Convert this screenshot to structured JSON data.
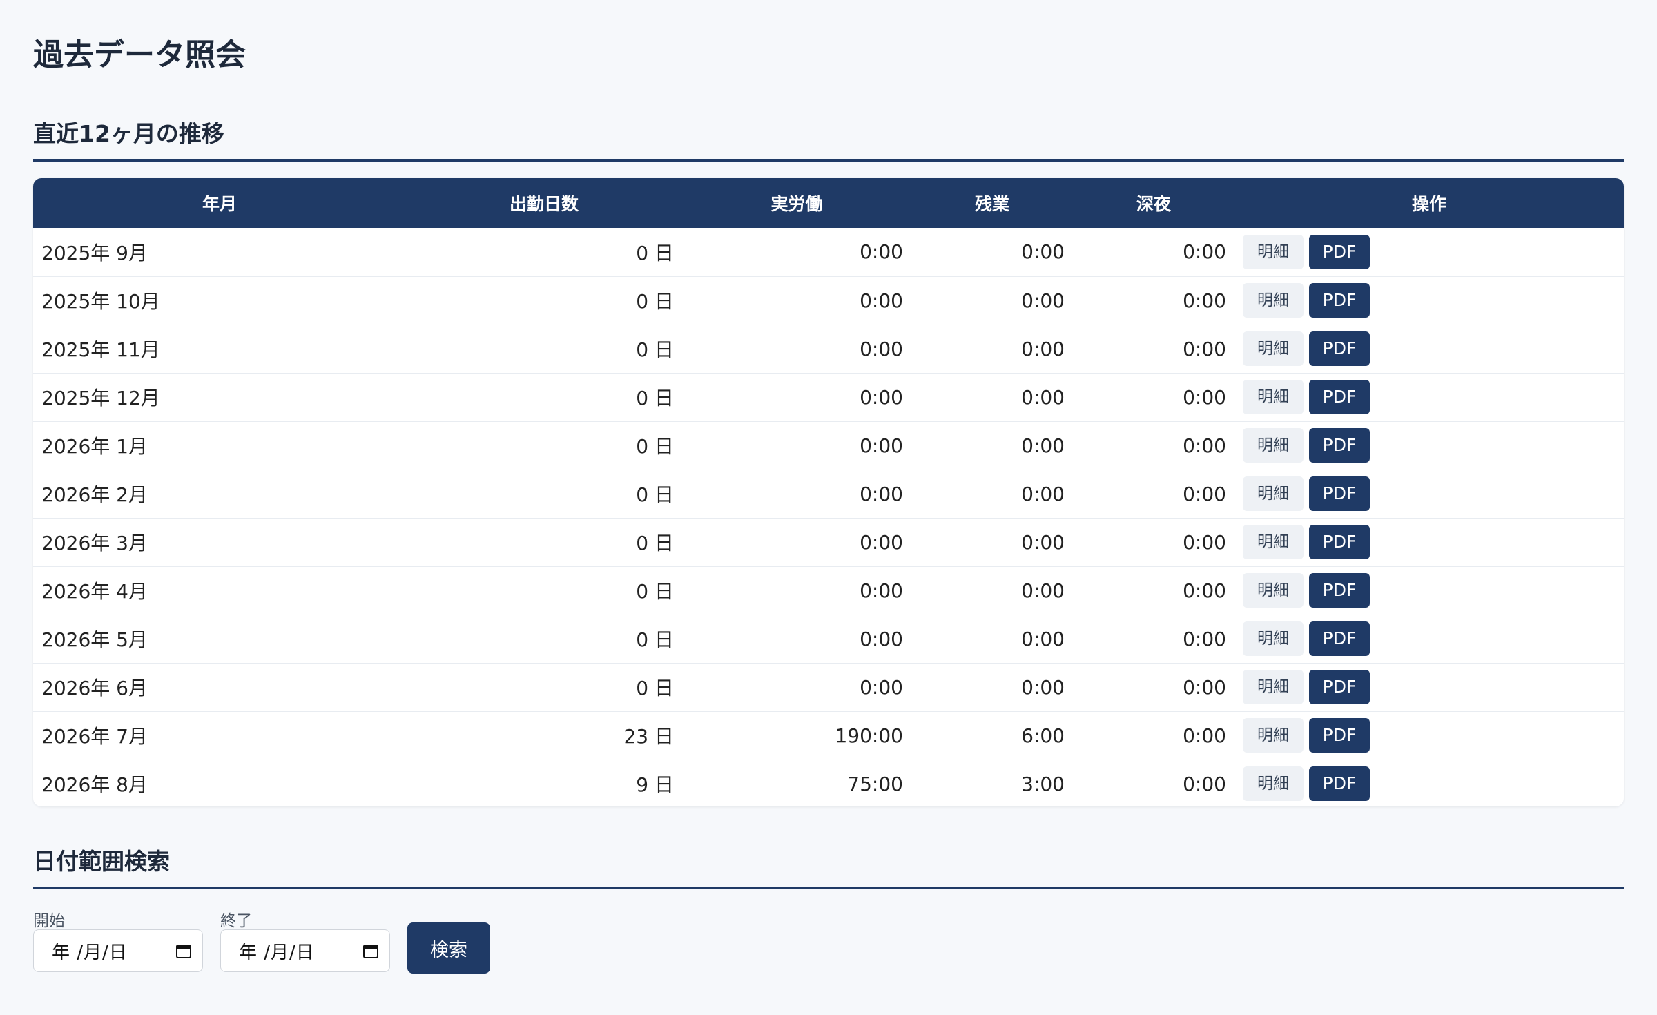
{
  "page": {
    "title": "過去データ照会"
  },
  "trend": {
    "title": "直近12ヶ月の推移",
    "columns": [
      "年月",
      "出勤日数",
      "実労働",
      "残業",
      "深夜",
      "操作"
    ],
    "detail_label": "明細",
    "pdf_label": "PDF",
    "rows": [
      {
        "ym": "2025年 9月",
        "days": "0 日",
        "work": "0:00",
        "overtime": "0:00",
        "night": "0:00"
      },
      {
        "ym": "2025年 10月",
        "days": "0 日",
        "work": "0:00",
        "overtime": "0:00",
        "night": "0:00"
      },
      {
        "ym": "2025年 11月",
        "days": "0 日",
        "work": "0:00",
        "overtime": "0:00",
        "night": "0:00"
      },
      {
        "ym": "2025年 12月",
        "days": "0 日",
        "work": "0:00",
        "overtime": "0:00",
        "night": "0:00"
      },
      {
        "ym": "2026年 1月",
        "days": "0 日",
        "work": "0:00",
        "overtime": "0:00",
        "night": "0:00"
      },
      {
        "ym": "2026年 2月",
        "days": "0 日",
        "work": "0:00",
        "overtime": "0:00",
        "night": "0:00"
      },
      {
        "ym": "2026年 3月",
        "days": "0 日",
        "work": "0:00",
        "overtime": "0:00",
        "night": "0:00"
      },
      {
        "ym": "2026年 4月",
        "days": "0 日",
        "work": "0:00",
        "overtime": "0:00",
        "night": "0:00"
      },
      {
        "ym": "2026年 5月",
        "days": "0 日",
        "work": "0:00",
        "overtime": "0:00",
        "night": "0:00"
      },
      {
        "ym": "2026年 6月",
        "days": "0 日",
        "work": "0:00",
        "overtime": "0:00",
        "night": "0:00"
      },
      {
        "ym": "2026年 7月",
        "days": "23 日",
        "work": "190:00",
        "overtime": "6:00",
        "night": "0:00"
      },
      {
        "ym": "2026年 8月",
        "days": "9 日",
        "work": "75:00",
        "overtime": "3:00",
        "night": "0:00"
      }
    ]
  },
  "search": {
    "title": "日付範囲検索",
    "start_label": "開始",
    "end_label": "終了",
    "start_value": "年 /月/日",
    "end_value": "年 /月/日",
    "button_label": "検索",
    "calendar_icon": "calendar-icon"
  },
  "colors": {
    "primary": "#1f3a66",
    "background": "#f6f8fb",
    "detail_button": "#eef1f5"
  }
}
